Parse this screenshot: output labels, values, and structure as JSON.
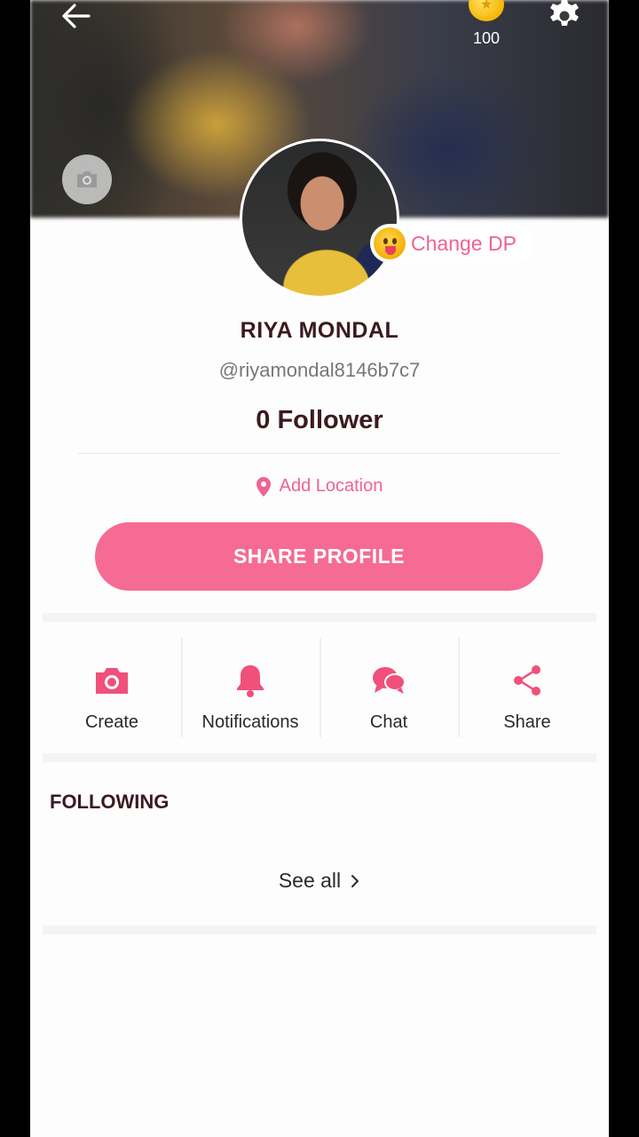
{
  "header": {
    "coins": "100"
  },
  "profile": {
    "change_dp_label": "Change DP",
    "name": "RIYA MONDAL",
    "handle": "@riyamondal8146b7c7",
    "followers": "0 Follower",
    "location_label": "Add Location",
    "share_profile_label": "SHARE PROFILE"
  },
  "actions": [
    {
      "label": "Create",
      "icon": "camera-icon"
    },
    {
      "label": "Notifications",
      "icon": "bell-icon"
    },
    {
      "label": "Chat",
      "icon": "chat-icon"
    },
    {
      "label": "Share",
      "icon": "share-icon"
    }
  ],
  "following": {
    "title": "FOLLOWING",
    "see_all_label": "See all"
  },
  "colors": {
    "accent": "#f56b94",
    "accent_text": "#f06292",
    "name_text": "#3b1a1f"
  }
}
